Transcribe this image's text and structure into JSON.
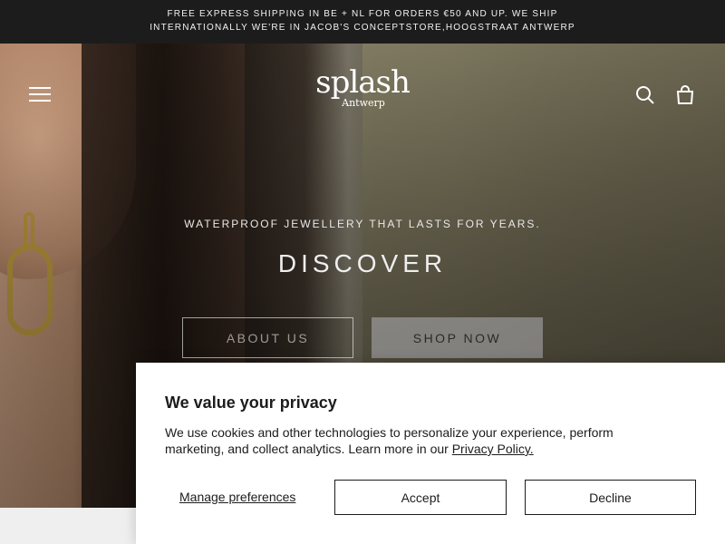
{
  "announcement": {
    "line1": "FREE EXPRESS SHIPPING IN BE    + NL    FOR ORDERS €50 AND UP. WE SHIP",
    "line2": "INTERNATIONALLY    WE'RE IN JACOB'S CONCEPTSTORE,HOOGSTRAAT ANTWERP"
  },
  "header": {
    "logo_name": "splash",
    "logo_sub": "Antwerp",
    "icons": {
      "menu": "menu-icon",
      "search": "search-icon",
      "cart": "bag-icon"
    }
  },
  "hero": {
    "tagline": "WATERPROOF JEWELLERY THAT LASTS FOR YEARS.",
    "title": "DISCOVER",
    "about_label": "ABOUT US",
    "shop_label": "SHOP NOW"
  },
  "cookie": {
    "title": "We value your privacy",
    "body": "We use cookies and other technologies to personalize your experience, perform marketing, and collect analytics. Learn more in our",
    "policy_link": "Privacy Policy.",
    "manage_label": "Manage preferences",
    "accept_label": "Accept",
    "decline_label": "Decline"
  },
  "colors": {
    "announcement_bg": "#1c1c1c",
    "text_dark": "#1c1c1c",
    "white": "#ffffff"
  }
}
